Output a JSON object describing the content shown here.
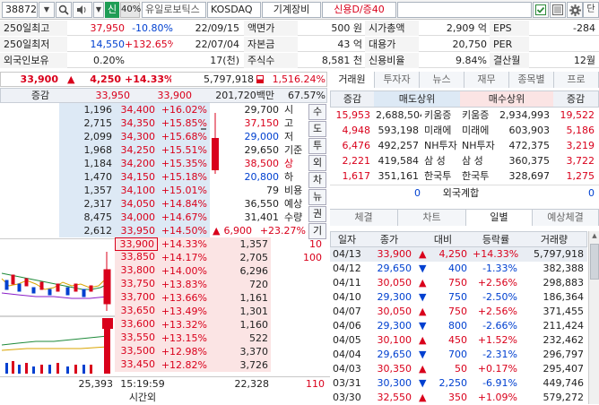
{
  "toolbar": {
    "code": "388720",
    "tag_sin": "신",
    "pct40": "40%",
    "name": "유일로보틱스",
    "market": "KOSDAQ",
    "sector": "기계장비",
    "credit": "신용D/증40",
    "bell": "▯",
    "dan": "단"
  },
  "info": [
    [
      "250일최고",
      "37,950",
      "-10.80%",
      "22/09/15",
      "액면가",
      "500 원",
      "시가총액",
      "2,909 억",
      "EPS",
      "-284"
    ],
    [
      "250일최저",
      "14,550",
      "+132.65%",
      "22/07/04",
      "자본금",
      "43 억",
      "대용가",
      "20,750",
      "PER",
      ""
    ],
    [
      "외국인보유",
      "0.20%",
      "",
      "17(천)",
      "주식수",
      "8,581 천",
      "신용비율",
      "9.84%",
      "결산월",
      "12월"
    ]
  ],
  "price": {
    "cur": "33,900",
    "arrow": "▲",
    "chg": "4,250",
    "pct": "+14.33%",
    "vol": "5,797,918",
    "prevvol": "1,516.24%"
  },
  "ob_header": {
    "label": "증감",
    "v1": "33,950",
    "v2": "33,900",
    "amt": "201,720백만",
    "pct": "67.57%"
  },
  "asks": [
    [
      "1,196",
      "34,400",
      "+16.02%"
    ],
    [
      "2,715",
      "34,350",
      "+15.85%"
    ],
    [
      "2,099",
      "34,300",
      "+15.68%"
    ],
    [
      "1,968",
      "34,250",
      "+15.51%"
    ],
    [
      "1,184",
      "34,200",
      "+15.35%"
    ],
    [
      "1,470",
      "34,150",
      "+15.18%"
    ],
    [
      "1,357",
      "34,100",
      "+15.01%"
    ],
    [
      "2,317",
      "34,050",
      "+14.84%"
    ],
    [
      "8,475",
      "34,000",
      "+14.67%"
    ],
    [
      "2,612",
      "33,950",
      "+14.50%"
    ]
  ],
  "side_info": [
    [
      "29,700",
      "시"
    ],
    [
      "37,150",
      "고"
    ],
    [
      "29,000",
      "저"
    ],
    [
      "29,650",
      "기준"
    ],
    [
      "38,500",
      "상"
    ],
    [
      "20,800",
      "하"
    ],
    [
      "79",
      "비용"
    ],
    [
      "36,550",
      "예상"
    ],
    [
      "31,401",
      "수량"
    ]
  ],
  "expected": {
    "arrow": "▲",
    "chg": "6,900",
    "pct": "+23.27%"
  },
  "vbtns": [
    "수",
    "도",
    "투",
    "외",
    "차",
    "뉴",
    "권",
    "기"
  ],
  "bids": [
    [
      "33,900",
      "+14.33%",
      "1,357",
      "10"
    ],
    [
      "33,850",
      "+14.17%",
      "2,705",
      "100"
    ],
    [
      "33,800",
      "+14.00%",
      "6,296",
      ""
    ],
    [
      "33,750",
      "+13.83%",
      "720",
      ""
    ],
    [
      "33,700",
      "+13.66%",
      "1,161",
      ""
    ],
    [
      "33,650",
      "+13.49%",
      "1,301",
      ""
    ],
    [
      "33,600",
      "+13.32%",
      "1,160",
      ""
    ],
    [
      "33,550",
      "+13.15%",
      "522",
      ""
    ],
    [
      "33,500",
      "+12.98%",
      "3,370",
      ""
    ],
    [
      "33,450",
      "+12.82%",
      "3,726",
      ""
    ]
  ],
  "ob_footer": {
    "total_ask": "25,393",
    "time": "15:19:59",
    "time_label": "시간외",
    "total_bid": "22,328",
    "net": "110"
  },
  "right_tabs": [
    "거래원",
    "투자자",
    "뉴스",
    "재무",
    "종목별",
    "프로"
  ],
  "broker_header": [
    "증감",
    "매도상위",
    "매수상위",
    "증감"
  ],
  "brokers": [
    [
      "15,953",
      "2,688,504",
      "키움증",
      "키움증",
      "2,934,993",
      "19,522"
    ],
    [
      "4,948",
      "593,198",
      "미래에",
      "미래에",
      "603,903",
      "5,186"
    ],
    [
      "6,476",
      "492,257",
      "NH투자",
      "NH투자",
      "472,375",
      "3,219"
    ],
    [
      "2,221",
      "419,584",
      "삼 성",
      "삼 성",
      "360,375",
      "3,722"
    ],
    [
      "1,617",
      "351,161",
      "한국투",
      "한국투",
      "328,697",
      "1,275"
    ]
  ],
  "foreign_sum": {
    "left": "0",
    "label": "외국계합",
    "right": "0"
  },
  "bottom_tabs": [
    "체결",
    "차트",
    "일별",
    "예상체결"
  ],
  "daily_header": [
    "일자",
    "종가",
    "대비",
    "등락률",
    "거래량"
  ],
  "daily": [
    [
      "04/13",
      "33,900",
      "▲",
      "4,250",
      "+14.33%",
      "5,797,918",
      "r"
    ],
    [
      "04/12",
      "29,650",
      "▼",
      "400",
      "-1.33%",
      "382,388",
      "b"
    ],
    [
      "04/11",
      "30,050",
      "▲",
      "750",
      "+2.56%",
      "298,883",
      "r"
    ],
    [
      "04/10",
      "29,300",
      "▼",
      "750",
      "-2.50%",
      "186,364",
      "b"
    ],
    [
      "04/07",
      "30,050",
      "▲",
      "750",
      "+2.56%",
      "371,455",
      "r"
    ],
    [
      "04/06",
      "29,300",
      "▼",
      "800",
      "-2.66%",
      "211,424",
      "b"
    ],
    [
      "04/05",
      "30,100",
      "▲",
      "450",
      "+1.52%",
      "232,462",
      "r"
    ],
    [
      "04/04",
      "29,650",
      "▼",
      "700",
      "-2.31%",
      "296,797",
      "b"
    ],
    [
      "04/03",
      "30,350",
      "▲",
      "50",
      "+0.17%",
      "295,407",
      "r"
    ],
    [
      "03/31",
      "30,300",
      "▼",
      "2,250",
      "-6.91%",
      "449,746",
      "b"
    ],
    [
      "03/30",
      "32,550",
      "▲",
      "350",
      "+1.09%",
      "579,272",
      "r"
    ]
  ],
  "colors": {
    "up": "#d9001b",
    "down": "#0040d0",
    "ask_bg": "#dde9f5",
    "bid_bg": "#fbe4e4"
  }
}
